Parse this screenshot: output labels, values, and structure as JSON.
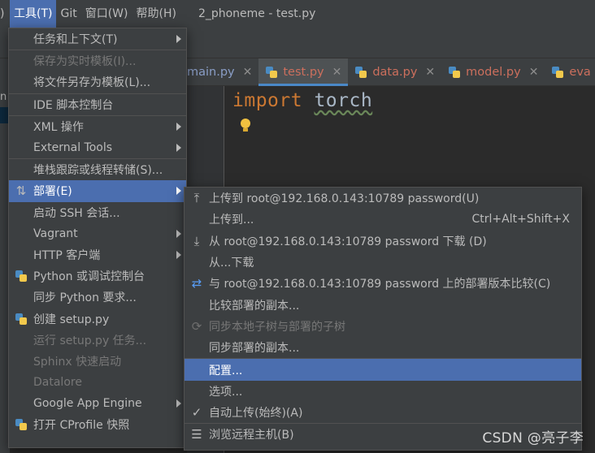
{
  "menubar": {
    "items": [
      "",
      "工具(T)",
      "Git",
      "窗口(W)",
      "帮助(H)"
    ],
    "window_title": "2_phoneme - test.py"
  },
  "leftstrip": {
    "letter": "n"
  },
  "tabs": [
    {
      "name": "main.py",
      "selected": false,
      "has_icon": false
    },
    {
      "name": "test.py",
      "selected": true,
      "has_icon": true
    },
    {
      "name": "data.py",
      "selected": false,
      "has_icon": true
    },
    {
      "name": "model.py",
      "selected": false,
      "has_icon": true
    },
    {
      "name": "eva",
      "selected": false,
      "has_icon": true
    }
  ],
  "editor": {
    "keyword": "import",
    "module": "torch"
  },
  "tools_menu": {
    "items": [
      {
        "label": "任务和上下文(T)",
        "submenu": true
      },
      {
        "label": "保存为实时模板(I)...",
        "disabled": true
      },
      {
        "label": "将文件另存为模板(L)..."
      },
      {
        "label": "IDE 脚本控制台"
      },
      {
        "label": "XML 操作",
        "submenu": true
      },
      {
        "label": "External Tools",
        "submenu": true
      },
      {
        "label": "堆栈跟踪或线程转储(S)..."
      },
      {
        "label": "部署(E)",
        "submenu": true,
        "selected": true,
        "icon": "deploy-icon"
      },
      {
        "label": "启动 SSH 会话..."
      },
      {
        "label": "Vagrant",
        "submenu": true
      },
      {
        "label": "HTTP 客户端",
        "submenu": true
      },
      {
        "label": "Python 或调试控制台",
        "icon": "python-icon"
      },
      {
        "label": "同步 Python 要求..."
      },
      {
        "label": "创建 setup.py",
        "icon": "python-icon"
      },
      {
        "label": "运行 setup.py 任务...",
        "disabled": true
      },
      {
        "label": "Sphinx 快速启动",
        "disabled": true
      },
      {
        "label": "Datalore",
        "disabled": true
      },
      {
        "label": "Google App Engine",
        "submenu": true
      },
      {
        "label": "打开 CProfile 快照",
        "icon": "python-icon"
      }
    ]
  },
  "deploy_menu": {
    "items": [
      {
        "label": "上传到 root@192.168.0.143:10789 password(U)",
        "icon": "upload-icon"
      },
      {
        "label": "上传到...",
        "shortcut": "Ctrl+Alt+Shift+X"
      },
      {
        "label": "从 root@192.168.0.143:10789 password 下载 (D)",
        "icon": "download-icon"
      },
      {
        "label": "从...下载"
      },
      {
        "label": "与 root@192.168.0.143:10789 password 上的部署版本比较(C)",
        "icon": "compare-icon"
      },
      {
        "label": "比较部署的副本..."
      },
      {
        "label": "同步本地子树与部署的子树",
        "disabled": true,
        "icon": "sync-icon"
      },
      {
        "label": "同步部署的副本..."
      },
      {
        "label": "配置...",
        "selected": true
      },
      {
        "label": "选项..."
      },
      {
        "label": "自动上传(始终)(A)",
        "icon": "check-icon"
      },
      {
        "label": "浏览远程主机(B)",
        "icon": "remote-host-icon"
      }
    ]
  },
  "watermark": "CSDN @亮子李"
}
